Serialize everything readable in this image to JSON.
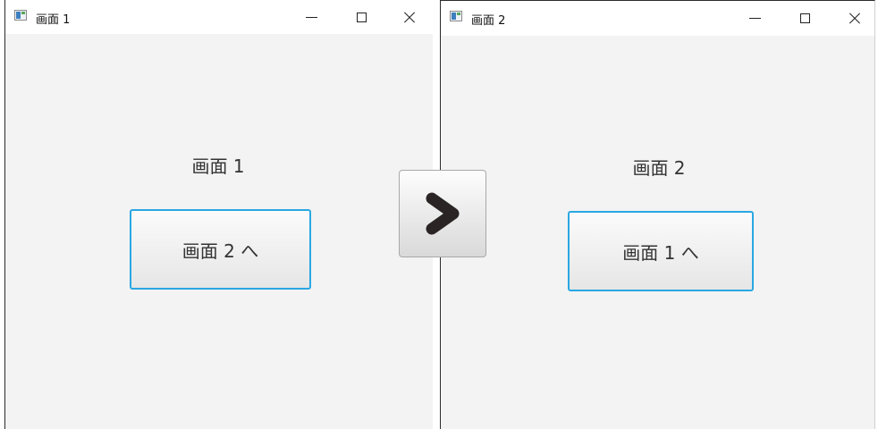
{
  "windows": [
    {
      "title": "画面 1",
      "screen_label": "画面 1",
      "button_label": "画面 2 へ",
      "controls": {
        "minimize": "minimize-icon",
        "maximize": "maximize-icon",
        "close": "close-icon"
      }
    },
    {
      "title": "画面 2",
      "screen_label": "画面 2",
      "button_label": "画面 1 へ",
      "controls": {
        "minimize": "minimize-icon",
        "maximize": "maximize-icon",
        "close": "close-icon"
      }
    }
  ],
  "transition_arrow": {
    "icon": "chevron-right-icon"
  },
  "colors": {
    "button_border": "#2aa7e3",
    "window_bg": "#f3f3f3",
    "titlebar_bg": "#ffffff",
    "arrow": "#2a2424"
  }
}
